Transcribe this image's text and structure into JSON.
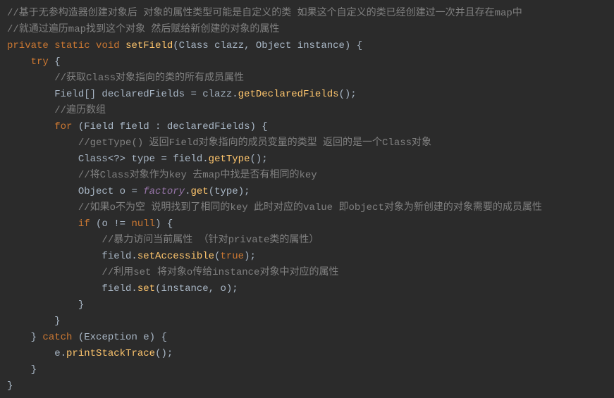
{
  "code": {
    "c01": "//基于无参构造器创建对象后 对象的属性类型可能是自定义的类 如果这个自定义的类已经创建过一次并且存在map中",
    "c02": "//就通过遍历map找到这个对象 然后赋给新创建的对象的属性",
    "kw_private": "private",
    "kw_static": "static",
    "kw_void": "void",
    "fn_setField": "setField",
    "sig_tail": "(Class clazz, Object instance) {",
    "kw_try": "try",
    "brace_open": " {",
    "c03": "//获取Class对象指向的类的所有成员属性",
    "l_fields_decl": "Field[] declaredFields = clazz.",
    "fn_getDeclaredFields": "getDeclaredFields",
    "paren_semi": "();",
    "c04": "//遍历数组",
    "kw_for": "for",
    "for_head": " (Field field : declaredFields) {",
    "c05": "//getType() 返回Field对象指向的成员变量的类型 返回的是一个Class对象",
    "l_type_lhs": "Class<?> type = field.",
    "fn_getType": "getType",
    "c06": "//将Class对象作为key 去map中找是否有相同的key",
    "l_obj_lhs": "Object o = ",
    "it_factory": "factory",
    "dot": ".",
    "fn_get": "get",
    "arg_type": "(type);",
    "c07": "//如果o不为空 说明找到了相同的key 此时对应的value 即object对象为新创建的对象需要的成员属性",
    "kw_if": "if",
    "if_head": " (o != ",
    "kw_null": "null",
    "if_tail": ") {",
    "c08": "//暴力访问当前属性 （针对private类的属性）",
    "l_set_acc_lhs": "field.",
    "fn_setAccessible": "setAccessible",
    "paren_open": "(",
    "kw_true": "true",
    "paren_close_semi": ");",
    "c09": "//利用set 将对象o传给instance对象中对应的属性",
    "fn_set": "set",
    "arg_inst_o": "(instance, o);",
    "brace_close": "}",
    "kw_catch": "catch",
    "catch_head": " (Exception e) {",
    "l_print": "e.",
    "fn_printStackTrace": "printStackTrace"
  }
}
